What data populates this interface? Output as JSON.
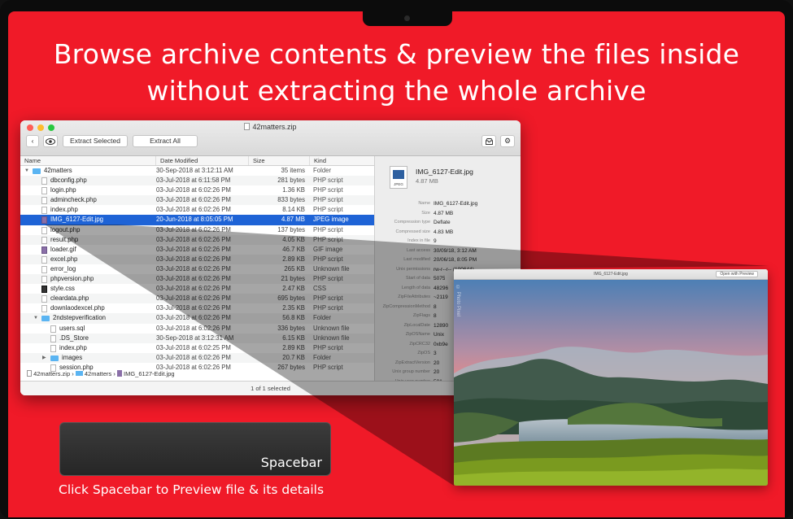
{
  "headline": {
    "line1": "Browse archive contents & preview the files inside",
    "line2": "without extracting the whole archive"
  },
  "window": {
    "title": "42matters.zip",
    "toolbar": {
      "extract_selected": "Extract Selected",
      "extract_all": "Extract All"
    },
    "columns": [
      "Name",
      "Date Modified",
      "Size",
      "Kind"
    ],
    "rows": [
      {
        "name": "42matters",
        "date": "30-Sep-2018 at 3:12:11 AM",
        "size": "35 items",
        "kind": "Folder",
        "type": "folder",
        "level": 0,
        "tri": "down"
      },
      {
        "name": "dbconfig.php",
        "date": "03-Jul-2018 at 6:11:58 PM",
        "size": "281 bytes",
        "kind": "PHP script",
        "type": "file",
        "level": 1
      },
      {
        "name": "login.php",
        "date": "03-Jul-2018 at 6:02:26 PM",
        "size": "1.36 KB",
        "kind": "PHP script",
        "type": "file",
        "level": 1
      },
      {
        "name": "admincheck.php",
        "date": "03-Jul-2018 at 6:02:26 PM",
        "size": "833 bytes",
        "kind": "PHP script",
        "type": "file",
        "level": 1
      },
      {
        "name": "index.php",
        "date": "03-Jul-2018 at 6:02:26 PM",
        "size": "8.14 KB",
        "kind": "PHP script",
        "type": "file",
        "level": 1
      },
      {
        "name": "IMG_6127-Edit.jpg",
        "date": "20-Jun-2018 at 8:05:05 PM",
        "size": "4.87 MB",
        "kind": "JPEG image",
        "type": "img",
        "level": 1,
        "selected": true
      },
      {
        "name": "logout.php",
        "date": "03-Jul-2018 at 6:02:26 PM",
        "size": "137 bytes",
        "kind": "PHP script",
        "type": "file",
        "level": 1
      },
      {
        "name": "result.php",
        "date": "03-Jul-2018 at 6:02:26 PM",
        "size": "4.05 KB",
        "kind": "PHP script",
        "type": "file",
        "level": 1
      },
      {
        "name": "loader.gif",
        "date": "03-Jul-2018 at 6:02:26 PM",
        "size": "46.7 KB",
        "kind": "GIF image",
        "type": "img",
        "level": 1
      },
      {
        "name": "excel.php",
        "date": "03-Jul-2018 at 6:02:26 PM",
        "size": "2.89 KB",
        "kind": "PHP script",
        "type": "file",
        "level": 1
      },
      {
        "name": "error_log",
        "date": "03-Jul-2018 at 6:02:26 PM",
        "size": "265 KB",
        "kind": "Unknown file",
        "type": "file",
        "level": 1
      },
      {
        "name": "phpversion.php",
        "date": "03-Jul-2018 at 6:02:26 PM",
        "size": "21 bytes",
        "kind": "PHP script",
        "type": "file",
        "level": 1
      },
      {
        "name": "style.css",
        "date": "03-Jul-2018 at 6:02:26 PM",
        "size": "2.47 KB",
        "kind": "CSS",
        "type": "css",
        "level": 1
      },
      {
        "name": "cleardata.php",
        "date": "03-Jul-2018 at 6:02:26 PM",
        "size": "695 bytes",
        "kind": "PHP script",
        "type": "file",
        "level": 1
      },
      {
        "name": "downlaodexcel.php",
        "date": "03-Jul-2018 at 6:02:26 PM",
        "size": "2.35 KB",
        "kind": "PHP script",
        "type": "file",
        "level": 1
      },
      {
        "name": "2ndstepverification",
        "date": "03-Jul-2018 at 6:02:26 PM",
        "size": "56.8 KB",
        "kind": "Folder",
        "type": "folder",
        "level": 1,
        "tri": "down"
      },
      {
        "name": "users.sql",
        "date": "03-Jul-2018 at 6:02:26 PM",
        "size": "336 bytes",
        "kind": "Unknown file",
        "type": "file",
        "level": 2
      },
      {
        "name": ".DS_Store",
        "date": "30-Sep-2018 at 3:12:31 AM",
        "size": "6.15 KB",
        "kind": "Unknown file",
        "type": "file",
        "level": 2
      },
      {
        "name": "index.php",
        "date": "03-Jul-2018 at 6:02:25 PM",
        "size": "2.89 KB",
        "kind": "PHP script",
        "type": "file",
        "level": 2
      },
      {
        "name": "images",
        "date": "03-Jul-2018 at 6:02:26 PM",
        "size": "20.7 KB",
        "kind": "Folder",
        "type": "folder",
        "level": 2,
        "tri": "right"
      },
      {
        "name": "session.php",
        "date": "03-Jul-2018 at 6:02:26 PM",
        "size": "267 bytes",
        "kind": "PHP script",
        "type": "file",
        "level": 2
      }
    ],
    "breadcrumb": [
      "42matters.zip",
      "42matters",
      "IMG_6127-Edit.jpg"
    ],
    "status_count": "1 of 1 selected",
    "info": {
      "title": "IMG_6127-Edit.jpg",
      "size": "4.87 MB",
      "icon_label": "JPEG",
      "rows": [
        {
          "k": "Name",
          "v": "IMG_6127-Edit.jpg"
        },
        {
          "k": "Size",
          "v": "4.87 MB"
        },
        {
          "k": "Compression type",
          "v": "Deflate"
        },
        {
          "k": "Compressed size",
          "v": "4.83 MB"
        },
        {
          "k": "Index in file",
          "v": "9"
        },
        {
          "k": "Last access",
          "v": "30/09/18, 3:12 AM"
        },
        {
          "k": "Last modified",
          "v": "20/06/18, 8:05 PM"
        },
        {
          "k": "Unix permissions",
          "v": "rw-r--r-- (100644)"
        },
        {
          "k": "Start of data",
          "v": "5075"
        },
        {
          "k": "Length of data",
          "v": "48296"
        },
        {
          "k": "ZipFileAttributes",
          "v": "~2119"
        },
        {
          "k": "ZipCompressionMethod",
          "v": "8"
        },
        {
          "k": "ZipFlags",
          "v": "8"
        },
        {
          "k": "ZipLocalDate",
          "v": "12890"
        },
        {
          "k": "ZipOSName",
          "v": "Unix"
        },
        {
          "k": "ZipCRC32",
          "v": "0xb9e"
        },
        {
          "k": "ZipOS",
          "v": "3"
        },
        {
          "k": "ZipExtractVersion",
          "v": "20"
        },
        {
          "k": "Unix group number",
          "v": "20"
        },
        {
          "k": "Unix user number",
          "v": "501"
        }
      ]
    }
  },
  "preview": {
    "title": "IMG_6127-Edit.jpg",
    "open_button": "Open with Preview",
    "watermark": "© Photo Pixel"
  },
  "spacebar": {
    "key_label": "Spacebar",
    "caption": "Click Spacebar to Preview file & its details"
  },
  "colors": {
    "background": "#f01a28",
    "selection": "#1e63d6"
  }
}
